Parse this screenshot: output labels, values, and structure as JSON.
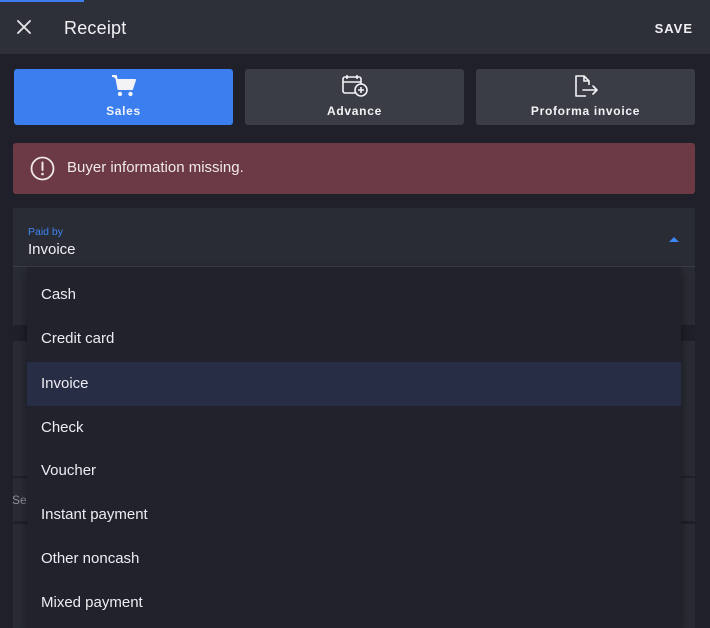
{
  "header": {
    "title": "Receipt",
    "save_label": "SAVE",
    "close_icon": "close-icon"
  },
  "tabs": [
    {
      "label": "Sales",
      "icon": "cart-icon",
      "active": true
    },
    {
      "label": "Advance",
      "icon": "calendar-add-icon",
      "active": false
    },
    {
      "label": "Proforma invoice",
      "icon": "document-export-icon",
      "active": false
    }
  ],
  "alert": {
    "icon": "alert-circle-icon",
    "message": "Buyer information missing.",
    "color": "#6b3a44"
  },
  "paid_by": {
    "label": "Paid by",
    "value": "Invoice"
  },
  "background_text": "Se",
  "dropdown": {
    "options": [
      "Cash",
      "Credit card",
      "Invoice",
      "Check",
      "Voucher",
      "Instant payment",
      "Other noncash",
      "Mixed payment"
    ],
    "selected": "Invoice"
  },
  "colors": {
    "accent": "#3b7ef0",
    "header_bg": "#2e3039",
    "page_bg": "#1f2029",
    "alert_bg": "#6b3a44"
  }
}
